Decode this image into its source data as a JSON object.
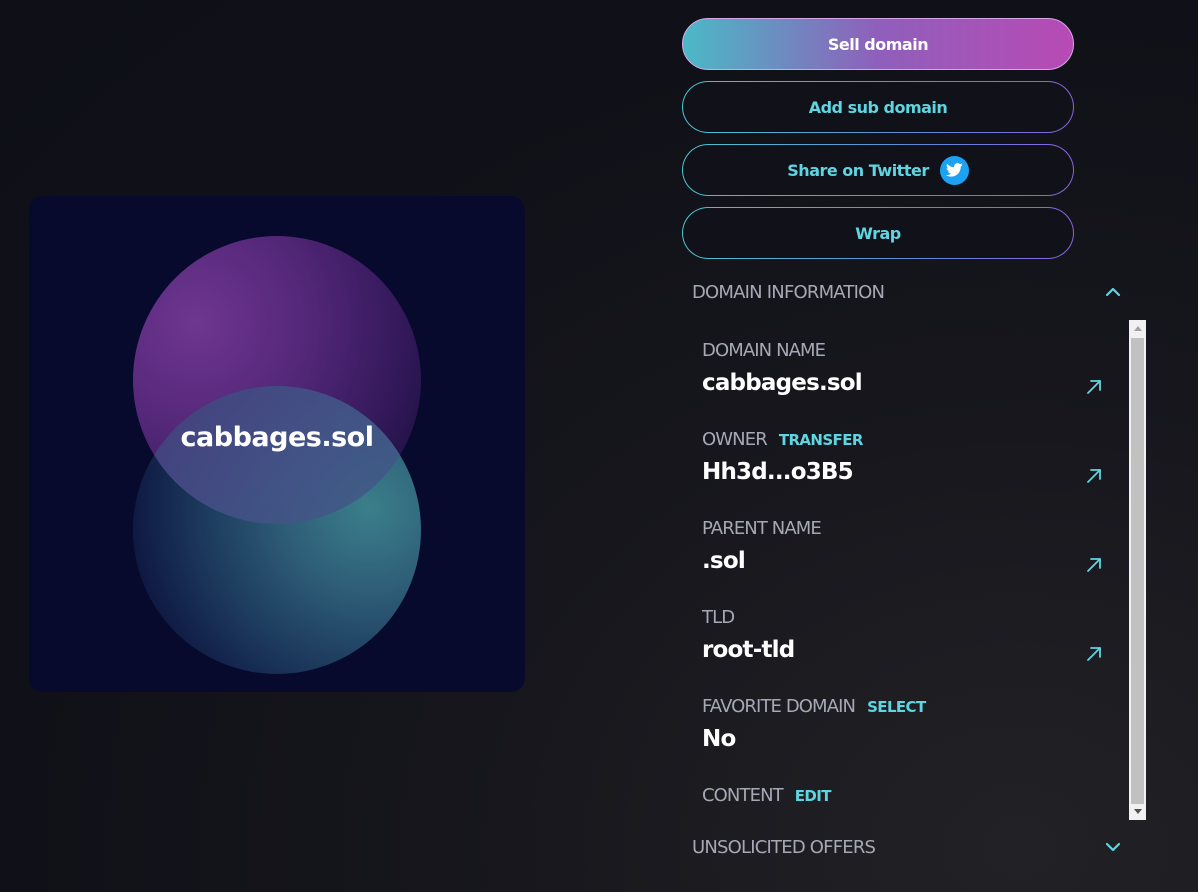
{
  "card": {
    "domain": "cabbages.sol"
  },
  "actions": {
    "sell": "Sell domain",
    "add_sub": "Add sub domain",
    "share": "Share on Twitter",
    "wrap": "Wrap"
  },
  "domain_info": {
    "header": "DOMAIN INFORMATION",
    "rows": [
      {
        "label": "DOMAIN NAME",
        "value": "cabbages.sol"
      },
      {
        "label": "OWNER",
        "action": "TRANSFER",
        "value": "Hh3d...o3B5"
      },
      {
        "label": "PARENT NAME",
        "value": ".sol"
      },
      {
        "label": "TLD",
        "value": "root-tld"
      },
      {
        "label": "FAVORITE DOMAIN",
        "action": "SELECT",
        "value": "No"
      },
      {
        "label": "CONTENT",
        "action": "EDIT"
      }
    ]
  },
  "offers": {
    "header": "UNSOLICITED OFFERS"
  },
  "icons": {
    "twitter": "twitter-bird-icon",
    "expand": "chevron-up-icon",
    "collapse": "chevron-down-icon",
    "external": "external-link-arrow-icon"
  },
  "colors": {
    "accent": "#5fd5e2",
    "label": "#a6a8b6",
    "sell_gradient_start": "#4bb9c6",
    "sell_gradient_end": "#b84ab5",
    "twitter": "#1da1f2",
    "card_bg": "#070a2c"
  }
}
